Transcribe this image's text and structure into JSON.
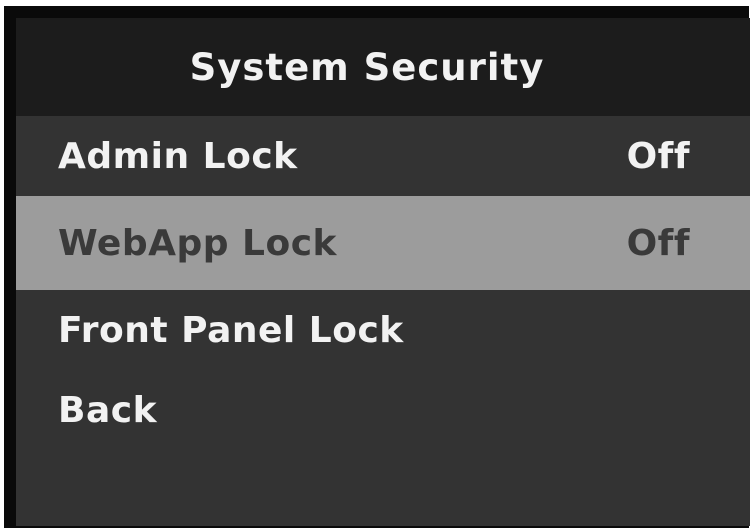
{
  "screen": {
    "title": "System Security"
  },
  "menu": {
    "items": [
      {
        "label": "Admin Lock",
        "value": "Off",
        "selected": false
      },
      {
        "label": "WebApp Lock",
        "value": "Off",
        "selected": true
      },
      {
        "label": "Front Panel Lock",
        "value": "",
        "selected": false
      },
      {
        "label": "Back",
        "value": "",
        "selected": false
      }
    ]
  },
  "colors": {
    "frame": "#0a0a0a",
    "header_bg": "#1c1c1c",
    "body_bg": "#333333",
    "selected_bg": "#9c9c9c",
    "text": "#f2f2f2",
    "selected_text": "#3a3a3a"
  }
}
